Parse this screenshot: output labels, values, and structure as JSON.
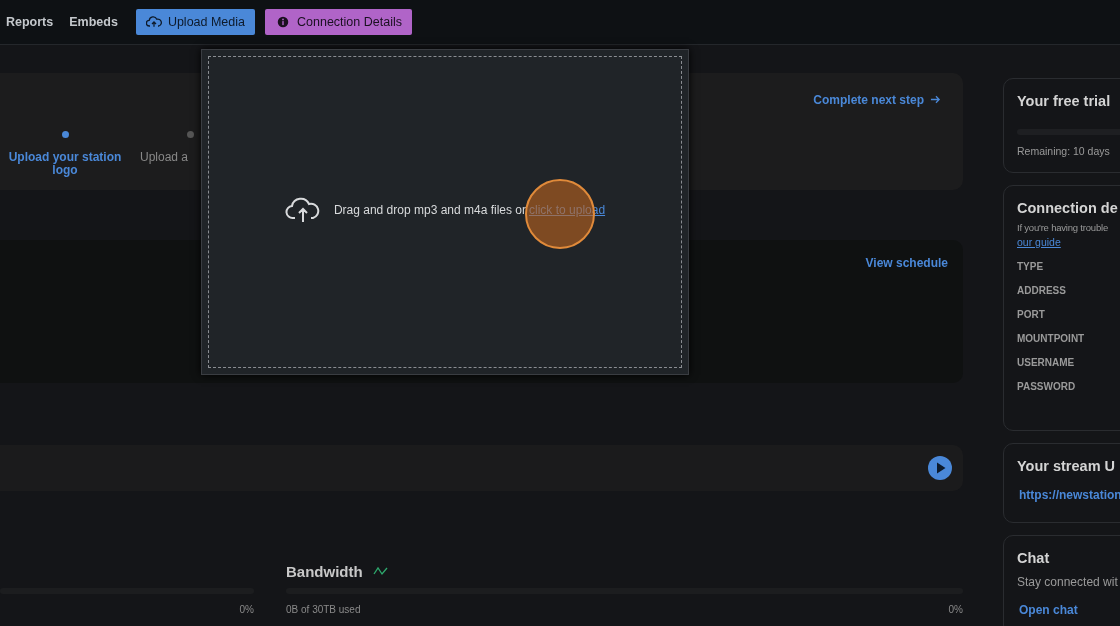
{
  "nav": {
    "links": [
      "Reports",
      "Embeds"
    ],
    "buttons": [
      {
        "label": "Upload Media",
        "kind": "upload"
      },
      {
        "label": "Connection Details",
        "kind": "info"
      }
    ]
  },
  "onboarding": {
    "action": "Complete next step",
    "steps": [
      {
        "label": "Upload your station logo",
        "selected": true
      },
      {
        "label": "Upload a",
        "selected": false
      }
    ]
  },
  "schedule": {
    "action": "View schedule"
  },
  "usage": [
    {
      "percent": "0%",
      "level": 0
    },
    {
      "title": "Bandwidth",
      "label": "0B of 30TB used",
      "percent": "0%",
      "level": 0
    }
  ],
  "sidebar": {
    "trial": {
      "title": "Your free trial",
      "level": 0,
      "remaining": "Remaining: 10 days"
    },
    "connection": {
      "title": "Connection de",
      "text": "If you're having trouble",
      "link": "our guide",
      "fields": [
        "TYPE",
        "ADDRESS",
        "PORT",
        "MOUNTPOINT",
        "USERNAME",
        "PASSWORD"
      ]
    },
    "stream": {
      "title": "Your stream U",
      "url": "https://newstation"
    },
    "chat": {
      "title": "Chat",
      "text": "Stay connected wit",
      "link": "Open chat"
    }
  },
  "upload_modal": {
    "text": "Drag and drop mp3 and m4a files or",
    "link": "click to upload"
  }
}
